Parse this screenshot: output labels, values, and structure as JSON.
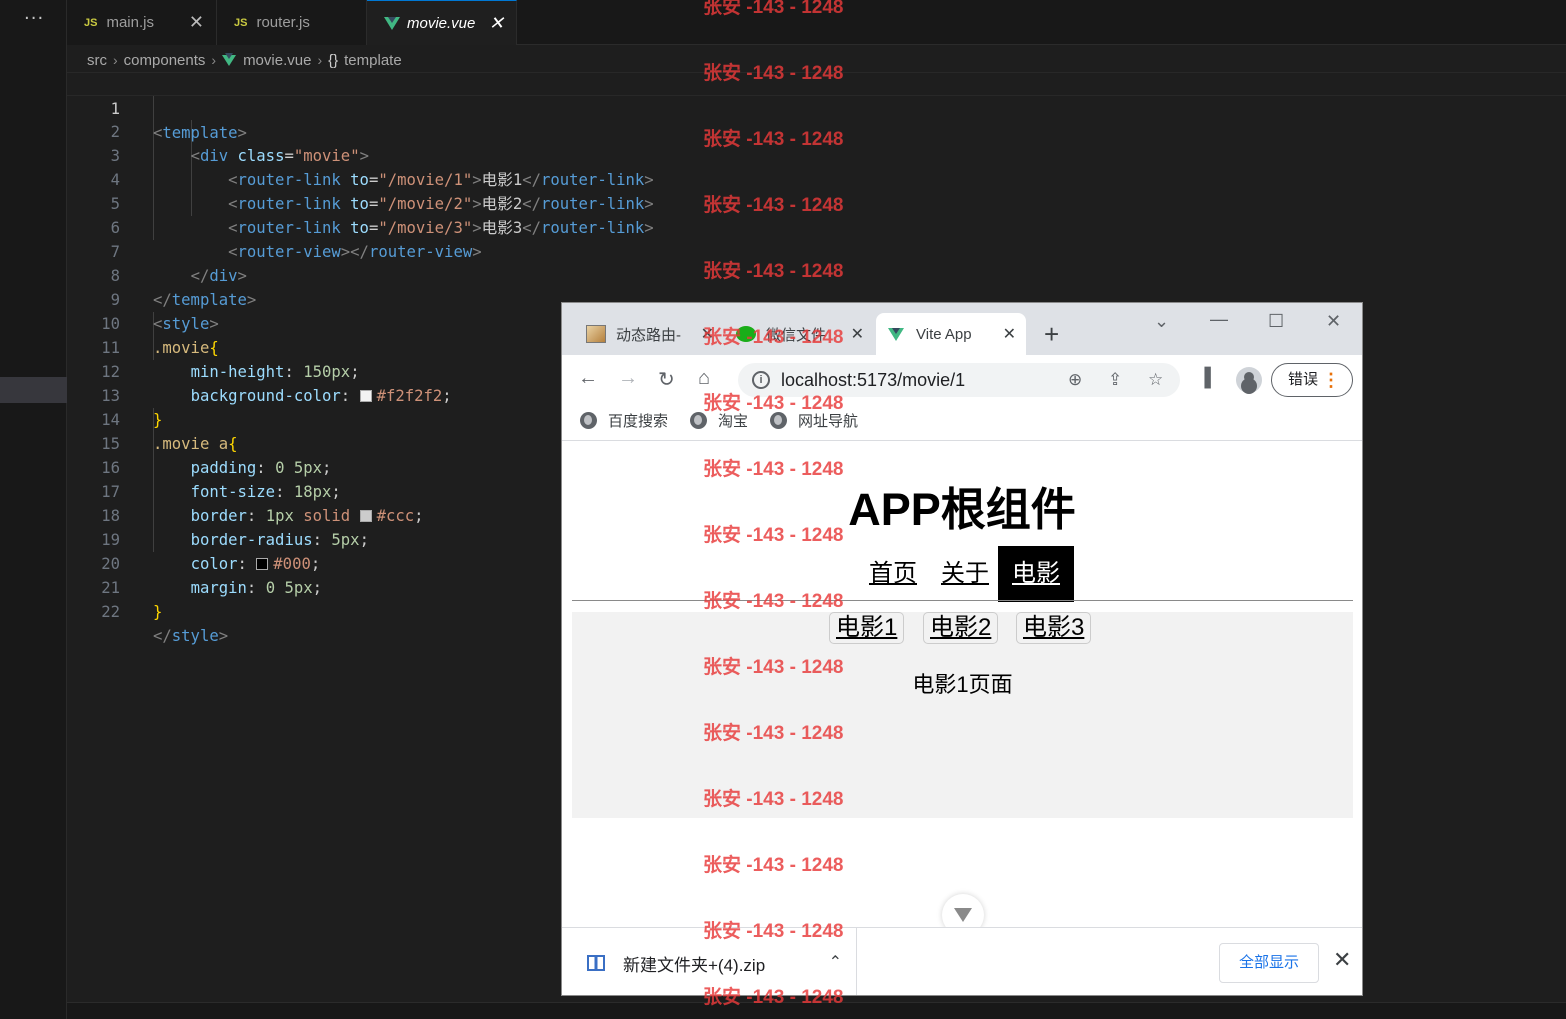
{
  "vscode": {
    "activity_dots": "···",
    "tabs": [
      {
        "badge": "JS",
        "label": "main.js",
        "close": "✕"
      },
      {
        "badge": "JS",
        "label": "router.js",
        "close": ""
      },
      {
        "badge": "",
        "label": "movie.vue",
        "close": "✕"
      }
    ],
    "breadcrumb": {
      "src": "src",
      "components": "components",
      "file": "movie.vue",
      "braces": "{}",
      "symbol": "template",
      "sep": "›"
    },
    "line_numbers": [
      "1",
      "2",
      "3",
      "4",
      "5",
      "6",
      "7",
      "8",
      "9",
      "10",
      "11",
      "12",
      "13",
      "14",
      "15",
      "16",
      "17",
      "18",
      "19",
      "20",
      "21",
      "22"
    ],
    "code": {
      "l1": {
        "open": "<",
        "tag": "template",
        "close": ">"
      },
      "l2": {
        "indent": "    ",
        "open": "<",
        "tag": "div",
        "attr": "class",
        "eq": "=",
        "val": "\"movie\"",
        "close": ">"
      },
      "l3": {
        "indent": "        ",
        "open": "<",
        "tag": "router-link",
        "attr": "to",
        "eq": "=",
        "val": "\"/movie/1\"",
        "gt": ">",
        "text": "电影1",
        "endopen": "</",
        "endtag": "router-link",
        "close": ">"
      },
      "l4": {
        "indent": "        ",
        "open": "<",
        "tag": "router-link",
        "attr": "to",
        "eq": "=",
        "val": "\"/movie/2\"",
        "gt": ">",
        "text": "电影2",
        "endopen": "</",
        "endtag": "router-link",
        "close": ">"
      },
      "l5": {
        "indent": "        ",
        "open": "<",
        "tag": "router-link",
        "attr": "to",
        "eq": "=",
        "val": "\"/movie/3\"",
        "gt": ">",
        "text": "电影3",
        "endopen": "</",
        "endtag": "router-link",
        "close": ">"
      },
      "l6": {
        "indent": "        ",
        "open": "<",
        "tag": "router-view",
        "gt": ">",
        "endopen": "</",
        "endtag": "router-view",
        "close": ">"
      },
      "l7": {
        "indent": "    ",
        "open": "</",
        "tag": "div",
        "close": ">"
      },
      "l8": {
        "open": "</",
        "tag": "template",
        "close": ">"
      },
      "l9": {
        "open": "<",
        "tag": "style",
        "close": ">"
      },
      "l10": {
        "sel": ".movie",
        "brace": "{"
      },
      "l11": {
        "indent": "    ",
        "prop": "min-height",
        "colon": ": ",
        "num": "150px",
        "semi": ";"
      },
      "l12": {
        "indent": "    ",
        "prop": "background-color",
        "colon": ": ",
        "val": "#f2f2f2",
        "semi": ";"
      },
      "l13": {
        "brace": "}"
      },
      "l14": {
        "sel": ".movie a",
        "brace": "{"
      },
      "l15": {
        "indent": "    ",
        "prop": "padding",
        "colon": ": ",
        "num": "0 5px",
        "semi": ";"
      },
      "l16": {
        "indent": "    ",
        "prop": "font-size",
        "colon": ": ",
        "num": "18px",
        "semi": ";"
      },
      "l17": {
        "indent": "    ",
        "prop": "border",
        "colon": ": ",
        "num": "1px",
        "kw": "solid",
        "val": "#ccc",
        "semi": ";"
      },
      "l18": {
        "indent": "    ",
        "prop": "border-radius",
        "colon": ": ",
        "num": "5px",
        "semi": ";"
      },
      "l19": {
        "indent": "    ",
        "prop": "color",
        "colon": ": ",
        "val": "#000",
        "semi": ";"
      },
      "l20": {
        "indent": "    ",
        "prop": "margin",
        "colon": ": ",
        "num": "0 5px",
        "semi": ";"
      },
      "l21": {
        "brace": "}"
      },
      "l22": {
        "open": "</",
        "tag": "style",
        "close": ">"
      }
    },
    "swatches": {
      "l12": "#f2f2f2",
      "l17": "#cccccc",
      "l19": "#000000"
    }
  },
  "watermark": {
    "text": "张安 -143 - 1248",
    "color": "#e83a3a",
    "rows": 16
  },
  "browser": {
    "tabs": [
      {
        "label": "动态路由-",
        "close": "✕"
      },
      {
        "label": "微信文件",
        "close": "✕"
      },
      {
        "label": "Vite App",
        "close": "✕"
      }
    ],
    "new_tab": "+",
    "window_controls": {
      "chevron": "⌄",
      "minimize": "—",
      "maximize": "☐",
      "close": "✕"
    },
    "nav": {
      "back": "←",
      "forward": "→",
      "reload": "↻",
      "home": "⌂"
    },
    "url": "localhost:5173/movie/1",
    "omnibox_icons": {
      "info": "i",
      "zoom": "⊕",
      "share": "⇪",
      "star": "☆"
    },
    "toolbar_icons": {
      "sidepanel": "▐"
    },
    "error_button": "错误",
    "error_dots": "⋮",
    "bookmarks": [
      "百度搜索",
      "淘宝",
      "网址导航"
    ],
    "page": {
      "title": "APP根组件",
      "nav": [
        "首页",
        "关于",
        "电影"
      ],
      "active_nav": "电影",
      "movie_links": [
        "电影1",
        "电影2",
        "电影3"
      ],
      "movie_page_text": "电影1页面"
    },
    "download": {
      "filename": "新建文件夹+(4).zip",
      "chevron": "⌃",
      "show_all": "全部显示",
      "close": "✕"
    }
  },
  "colors": {
    "vscode_bg": "#1e1e1e",
    "vue_green": "#41b883",
    "tab_active_border": "#0078d4",
    "link_blue": "#1a73e8"
  }
}
